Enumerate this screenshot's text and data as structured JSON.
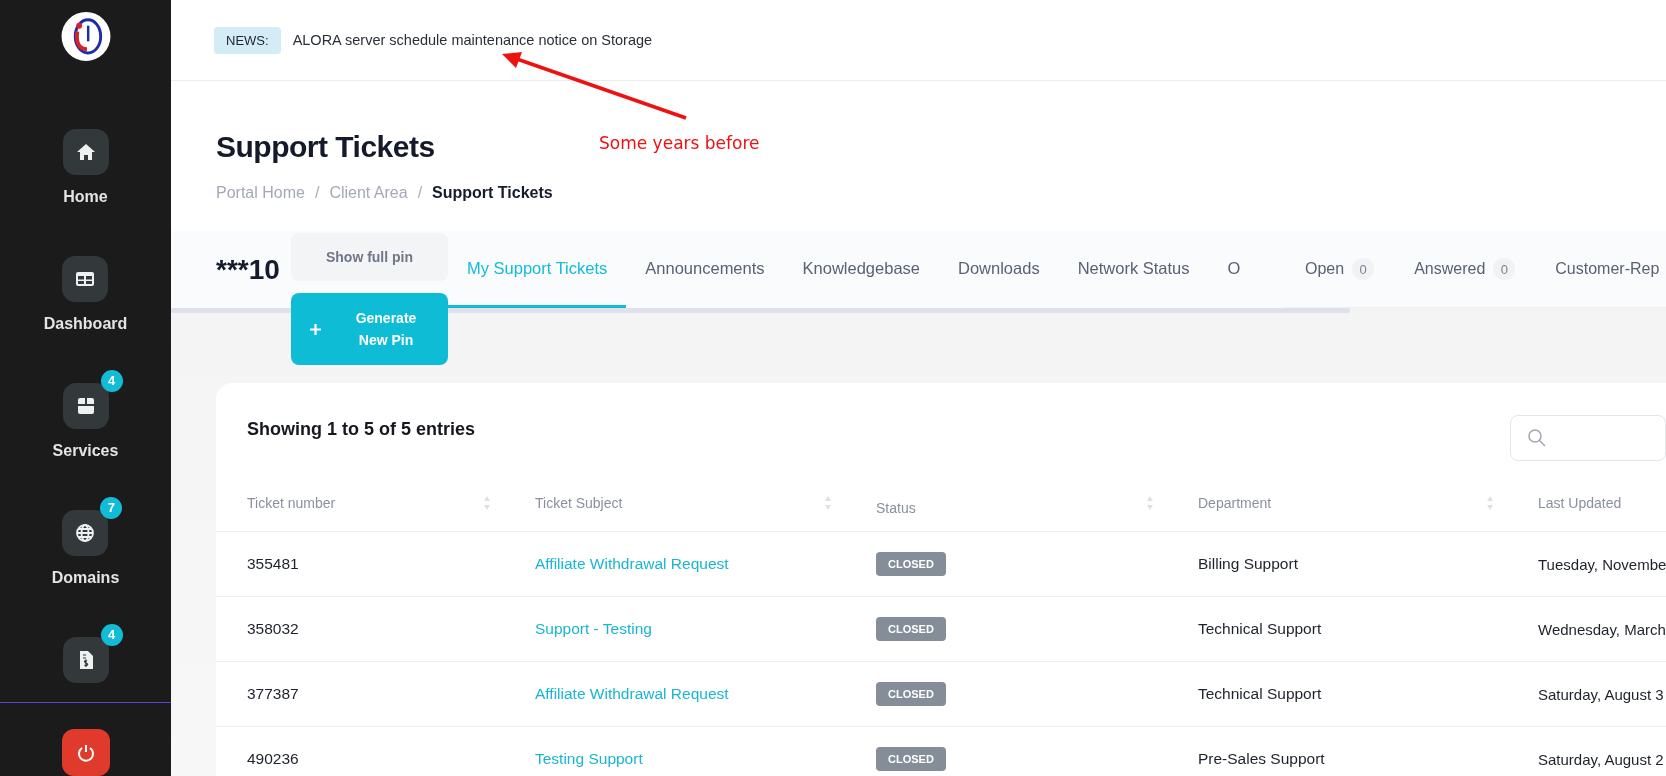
{
  "sidebar": {
    "items": [
      {
        "label": "Home"
      },
      {
        "label": "Dashboard"
      },
      {
        "label": "Services",
        "badge": "4"
      },
      {
        "label": "Domains",
        "badge": "7"
      },
      {
        "badge": "4"
      }
    ]
  },
  "news": {
    "tag": "NEWS:",
    "text": "ALORA server schedule maintenance notice on Storage"
  },
  "annotation": {
    "text": "Some years before"
  },
  "page": {
    "title": "Support Tickets",
    "breadcrumb": {
      "separator": "/",
      "items": [
        {
          "label": "Portal Home",
          "current": false
        },
        {
          "label": "Client Area",
          "current": false
        },
        {
          "label": "Support Tickets",
          "current": true
        }
      ]
    }
  },
  "pin": {
    "value": "***10",
    "show_button": "Show full pin",
    "generate_button": "Generate New Pin"
  },
  "tabs": [
    {
      "label": "My Support Tickets",
      "selected": true
    },
    {
      "label": "Announcements",
      "selected": false
    },
    {
      "label": "Knowledgebase",
      "selected": false
    },
    {
      "label": "Downloads",
      "selected": false
    },
    {
      "label": "Network Status",
      "selected": false
    },
    {
      "label": "O",
      "selected": false
    }
  ],
  "status_filters": [
    {
      "label": "Open",
      "count": "0"
    },
    {
      "label": "Answered",
      "count": "0"
    },
    {
      "label": "Customer-Rep"
    }
  ],
  "table": {
    "summary": "Showing 1 to 5 of 5 entries",
    "columns": [
      {
        "label": "Ticket number",
        "sortable": true
      },
      {
        "label": "Ticket Subject",
        "sortable": true
      },
      {
        "label": "Status",
        "sortable": true
      },
      {
        "label": "Department",
        "sortable": true
      },
      {
        "label": "Last Updated",
        "sortable": false
      }
    ],
    "rows": [
      {
        "number": "355481",
        "subject": "Affiliate Withdrawal Request",
        "status": "CLOSED",
        "department": "Billing Support",
        "last_updated": "Tuesday, Novembe"
      },
      {
        "number": "358032",
        "subject": "Support - Testing",
        "status": "CLOSED",
        "department": "Technical Support",
        "last_updated": "Wednesday, March"
      },
      {
        "number": "377387",
        "subject": "Affiliate Withdrawal Request",
        "status": "CLOSED",
        "department": "Technical Support",
        "last_updated": "Saturday, August 3"
      },
      {
        "number": "490236",
        "subject": "Testing Support",
        "status": "CLOSED",
        "department": "Pre-Sales Support",
        "last_updated": "Saturday, August 2"
      }
    ]
  }
}
